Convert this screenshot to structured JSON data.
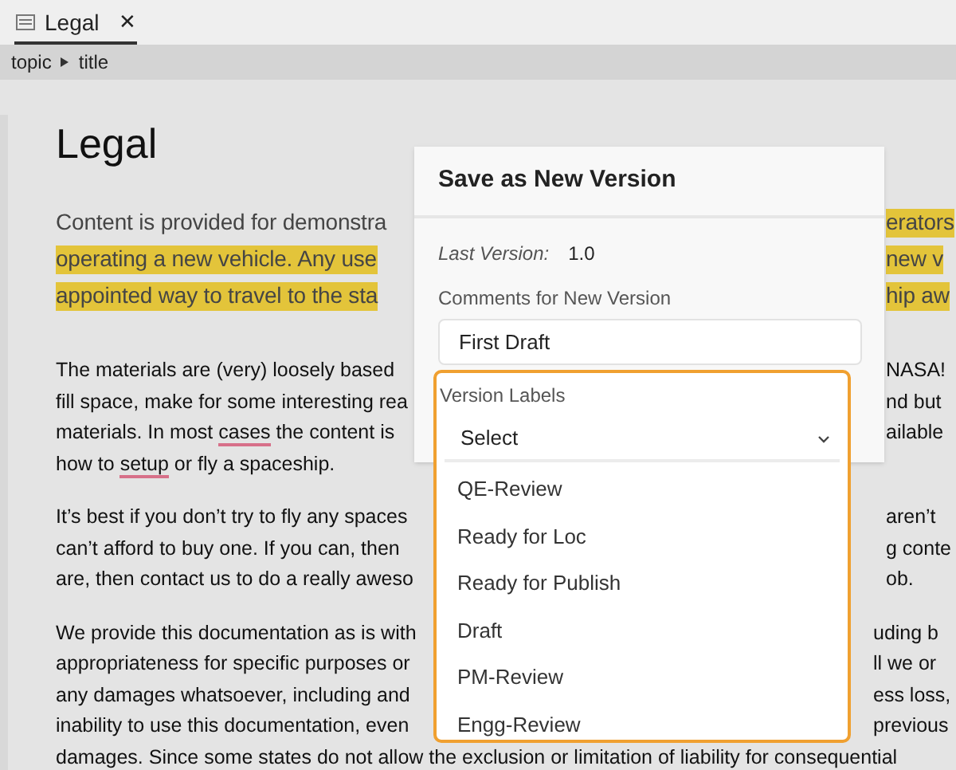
{
  "tab": {
    "label": "Legal",
    "close": "✕"
  },
  "breadcrumb": [
    "topic",
    "title"
  ],
  "document": {
    "title": "Legal",
    "paragraphs": [
      {
        "kind": "lead",
        "lines": [
          {
            "left": [
              {
                "text": "Content is provided for demonstra",
                "highlighted": false,
                "misspelled": false
              }
            ],
            "right": [
              {
                "text": "erators",
                "highlighted": true,
                "misspelled": false
              }
            ]
          },
          {
            "left": [
              {
                "text": "operating a new vehicle. ",
                "highlighted": true,
                "misspelled": false
              },
              {
                "text": "Any use",
                "highlighted": true,
                "misspelled": false
              }
            ],
            "right": [
              {
                "text": "new v",
                "highlighted": true,
                "misspelled": false
              }
            ]
          },
          {
            "left": [
              {
                "text": "appointed way to travel to the sta",
                "highlighted": true,
                "misspelled": false
              }
            ],
            "right": [
              {
                "text": "hip aw",
                "highlighted": true,
                "misspelled": false
              }
            ]
          }
        ]
      },
      {
        "kind": "body",
        "lines": [
          {
            "left": [
              {
                "text": "The materials are (very) loosely based",
                "highlighted": false,
                "misspelled": false
              }
            ],
            "right": [
              {
                "text": "NASA!",
                "highlighted": false,
                "misspelled": false
              }
            ]
          },
          {
            "left": [
              {
                "text": "fill space, make for some interesting rea",
                "highlighted": false,
                "misspelled": false
              }
            ],
            "right": [
              {
                "text": "nd but",
                "highlighted": false,
                "misspelled": false
              }
            ]
          },
          {
            "left": [
              {
                "text": "materials. In most ",
                "highlighted": false,
                "misspelled": false
              },
              {
                "text": "cases",
                "highlighted": false,
                "misspelled": true
              },
              {
                "text": " the content is",
                "highlighted": false,
                "misspelled": false
              }
            ],
            "right": [
              {
                "text": "ailable",
                "highlighted": false,
                "misspelled": false
              }
            ]
          },
          {
            "left": [
              {
                "text": "how to ",
                "highlighted": false,
                "misspelled": false
              },
              {
                "text": "setup",
                "highlighted": false,
                "misspelled": true
              },
              {
                "text": " or fly a spaceship.",
                "highlighted": false,
                "misspelled": false
              }
            ]
          }
        ]
      },
      {
        "kind": "body",
        "lines": [
          {
            "left": [
              {
                "text": "It’s best if you don’t try to fly any spaces",
                "highlighted": false,
                "misspelled": false
              }
            ],
            "right": [
              {
                "text": "aren’t",
                "highlighted": false,
                "misspelled": false
              }
            ]
          },
          {
            "left": [
              {
                "text": "can’t afford to buy one. If you can, then",
                "highlighted": false,
                "misspelled": false
              }
            ],
            "right": [
              {
                "text": "g conte",
                "highlighted": false,
                "misspelled": false
              }
            ]
          },
          {
            "left": [
              {
                "text": "are, then contact us to do a really aweso",
                "highlighted": false,
                "misspelled": false
              }
            ],
            "right": [
              {
                "text": "ob.",
                "highlighted": false,
                "misspelled": false
              }
            ]
          }
        ]
      },
      {
        "kind": "body",
        "lines": [
          {
            "left": [
              {
                "text": "We provide this documentation as is with",
                "highlighted": false,
                "misspelled": false
              }
            ],
            "right": [
              {
                "text": "uding b",
                "highlighted": false,
                "misspelled": false
              }
            ]
          },
          {
            "left": [
              {
                "text": "appropriateness for specific purposes or",
                "highlighted": false,
                "misspelled": false
              }
            ],
            "right": [
              {
                "text": "ll we or",
                "highlighted": false,
                "misspelled": false
              }
            ]
          },
          {
            "left": [
              {
                "text": "any damages whatsoever, including and",
                "highlighted": false,
                "misspelled": false
              }
            ],
            "right": [
              {
                "text": "ess loss,",
                "highlighted": false,
                "misspelled": false
              }
            ]
          },
          {
            "left": [
              {
                "text": "inability to use this documentation, even",
                "highlighted": false,
                "misspelled": false
              }
            ],
            "right": [
              {
                "text": "previous",
                "highlighted": false,
                "misspelled": false
              }
            ]
          },
          {
            "left": [
              {
                "text": "damages. Since some states do not allow the exclusion or limitation of liability for consequential",
                "highlighted": false,
                "misspelled": false
              }
            ]
          }
        ]
      }
    ]
  },
  "dialog": {
    "title": "Save as New Version",
    "last_version_label": "Last Version:",
    "last_version": "1.0",
    "comments_label": "Comments for New Version",
    "comments_value": "First Draft",
    "labels_label": "Version Labels",
    "select_placeholder": "Select",
    "options": [
      {
        "label": "QE-Review",
        "selected": false
      },
      {
        "label": "Ready for Loc",
        "selected": false
      },
      {
        "label": "Ready for Publish",
        "selected": false
      },
      {
        "label": "Draft",
        "selected": false
      },
      {
        "label": "PM-Review",
        "selected": false
      },
      {
        "label": "Engg-Review",
        "selected": false
      }
    ]
  }
}
